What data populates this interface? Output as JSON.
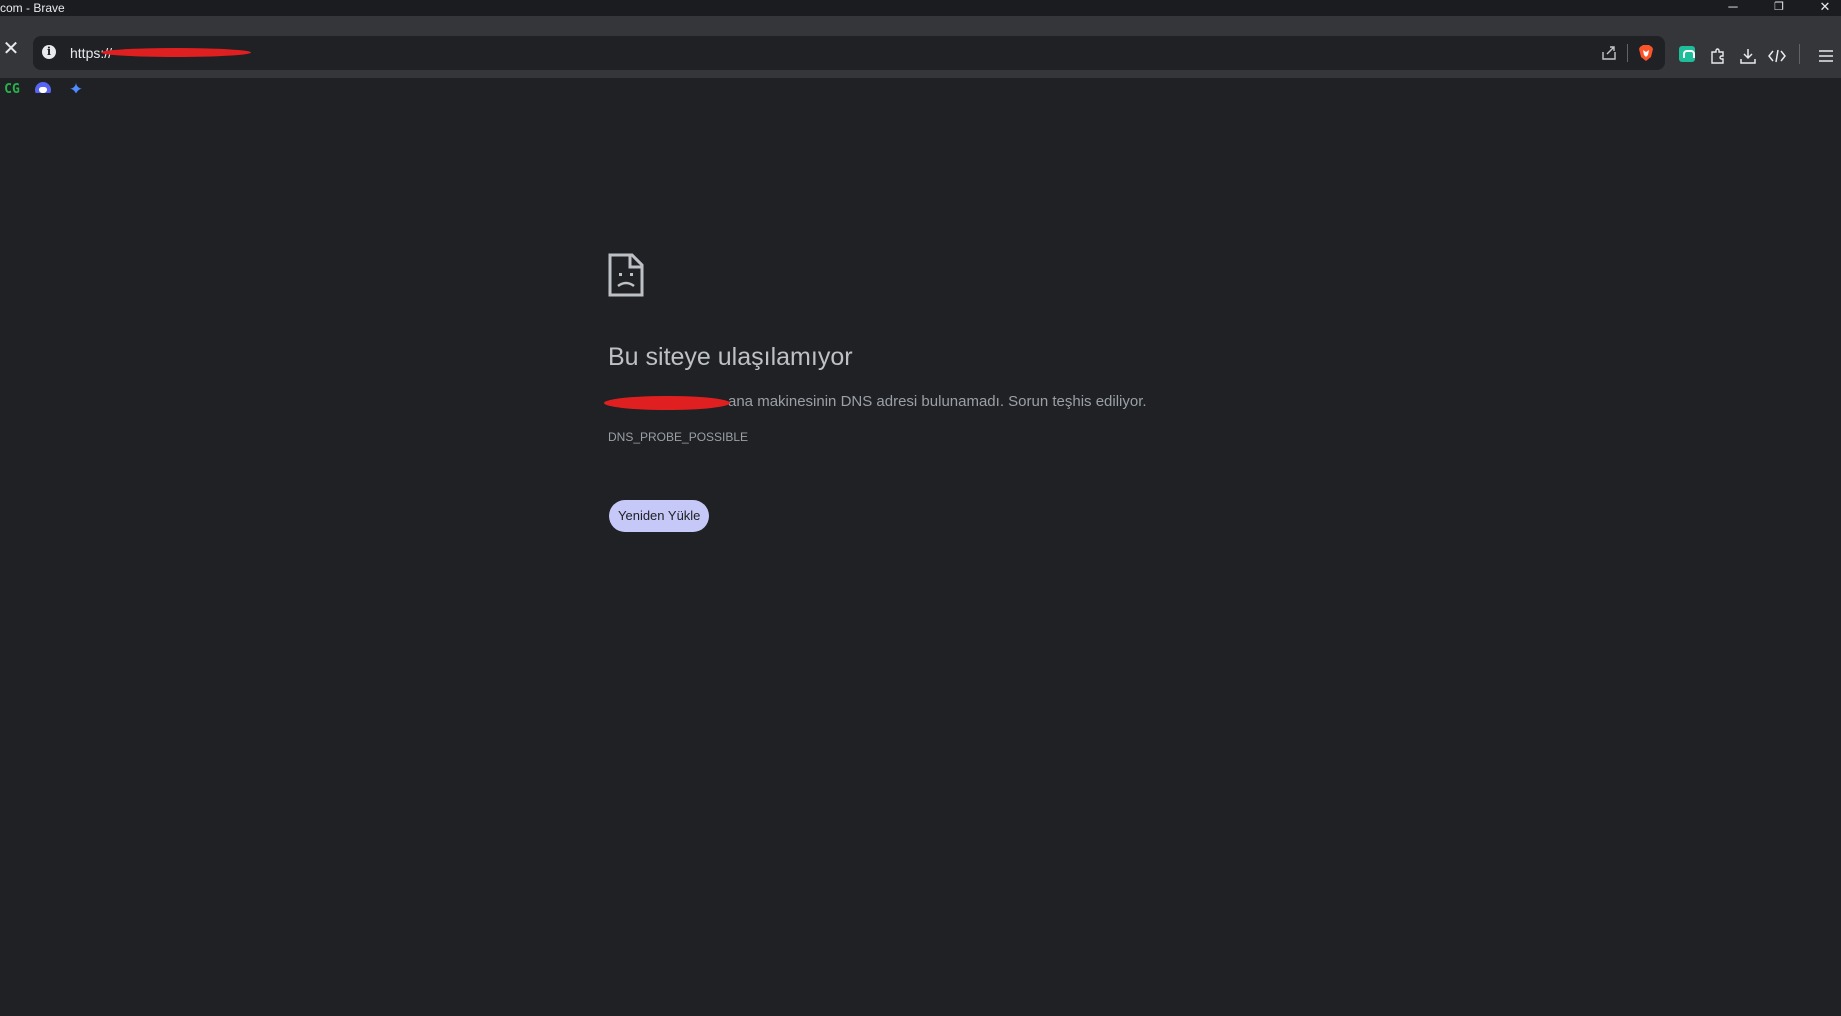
{
  "window": {
    "title": "com - Brave",
    "minimize_glyph": "─",
    "restore_glyph": "❐",
    "close_glyph": "✕"
  },
  "toolbar": {
    "stop_glyph": "✕",
    "url": "https://",
    "icons": {
      "share": "share-icon",
      "brave": "brave-shields-icon",
      "extension": "extension-icon",
      "puzzle": "extensions-puzzle-icon",
      "download": "download-icon",
      "devtools": "code-icon",
      "menu": "menu-icon"
    }
  },
  "bookmarks": [
    {
      "label": "CG",
      "icon": "cg-icon"
    },
    {
      "label": "",
      "icon": "discord-icon"
    },
    {
      "label": "",
      "icon": "gemini-icon"
    }
  ],
  "error": {
    "title": "Bu siteye ulaşılamıyor",
    "description": "ana makinesinin DNS adresi bulunamadı. Sorun teşhis ediliyor.",
    "code": "DNS_PROBE_POSSIBLE",
    "reload_label": "Yeniden Yükle"
  },
  "colors": {
    "background": "#202124",
    "toolbar": "#35363a",
    "button": "#c6c8f8",
    "redaction": "#e02020"
  }
}
